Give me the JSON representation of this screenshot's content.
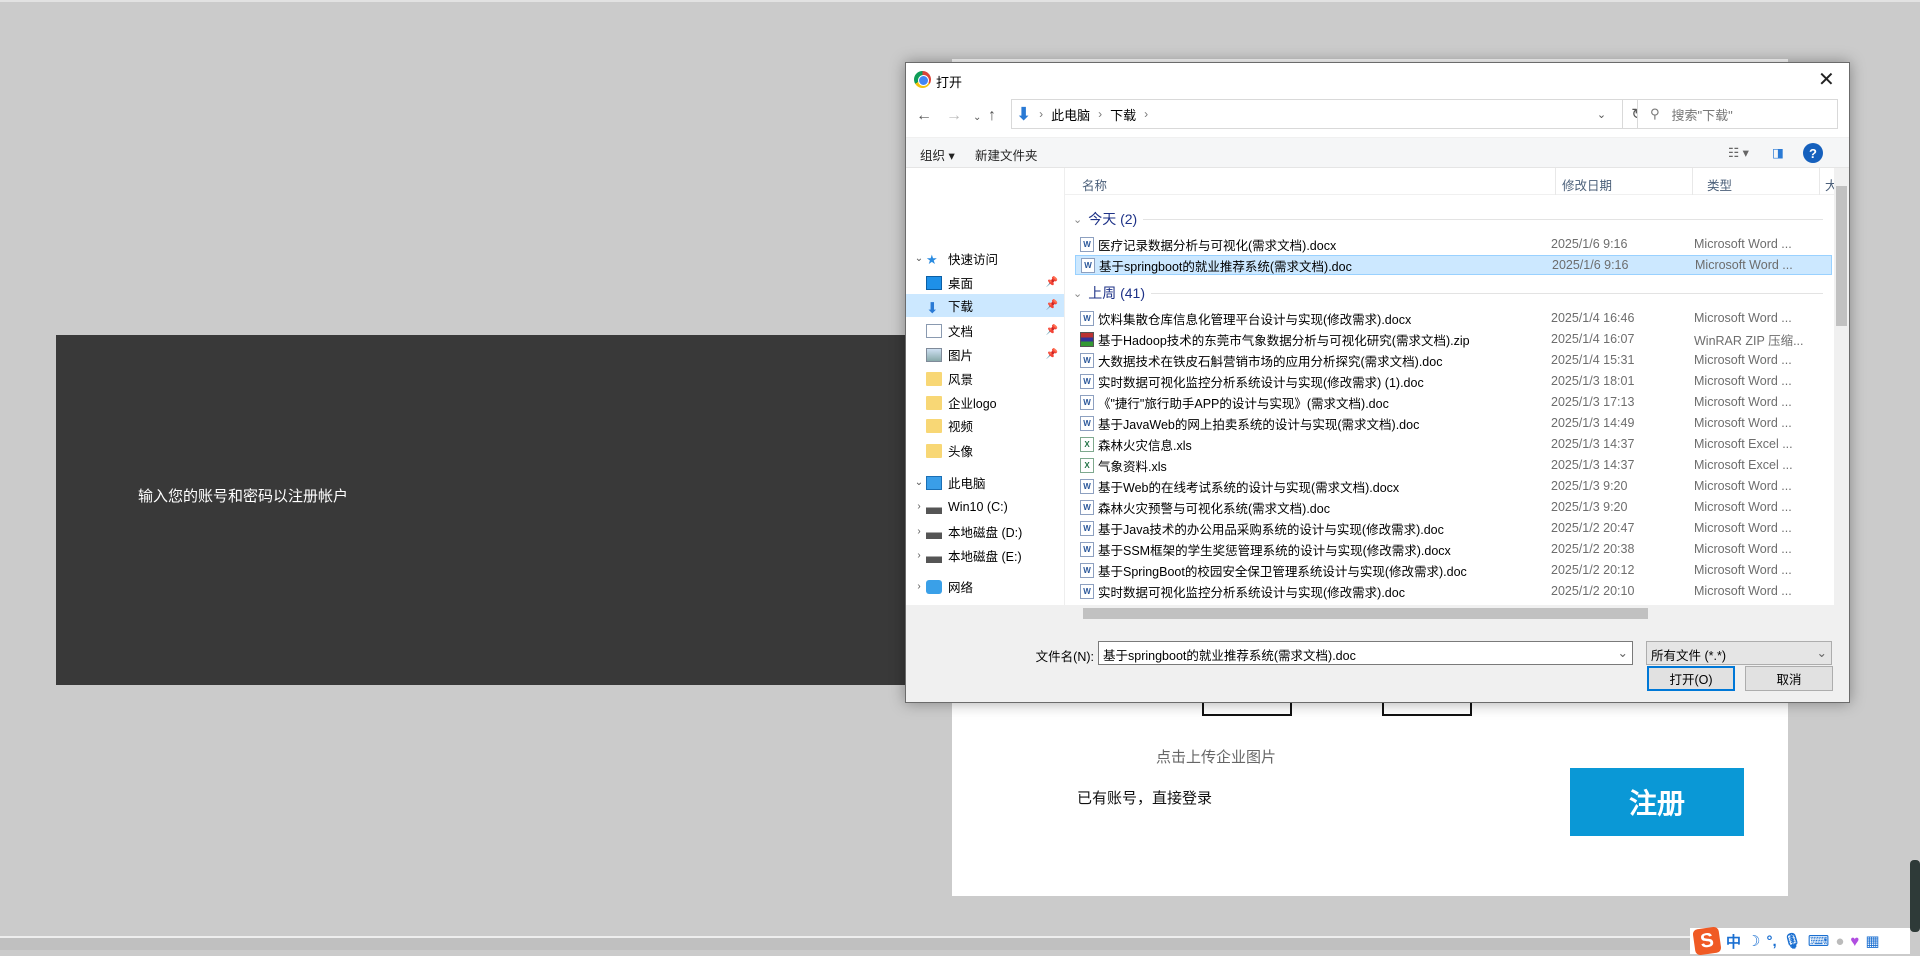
{
  "page": {
    "prompt": "输入您的账号和密码以注册帐户",
    "upload_text": "点击上传企业图片",
    "login_link": "已有账号，直接登录",
    "register_label": "注册",
    "accent": "#0a98d6",
    "panel_color": "#393939"
  },
  "ime": {
    "logo": "S",
    "mode": "中",
    "icons": [
      "moon-icon",
      "punctuation-icon",
      "microphone-icon",
      "keyboard-icon",
      "user-icon",
      "skin-icon",
      "apps-icon"
    ]
  },
  "dialog": {
    "title": "打开",
    "breadcrumb": [
      "此电脑",
      "下载"
    ],
    "search_placeholder": "搜索\"下载\"",
    "toolbar": {
      "organize": "组织 ▾",
      "new_folder": "新建文件夹"
    },
    "columns": {
      "name": "名称",
      "date": "修改日期",
      "type": "类型",
      "size": "大"
    },
    "sidebar": [
      {
        "label": "快速访问",
        "icon": "star-icon",
        "level": 0,
        "expand": "⌄"
      },
      {
        "label": "桌面",
        "icon": "desktop-icon",
        "level": 1,
        "pin": true
      },
      {
        "label": "下载",
        "icon": "download-icon",
        "level": 1,
        "pin": true,
        "selected": true
      },
      {
        "label": "文档",
        "icon": "document-icon",
        "level": 1,
        "pin": true
      },
      {
        "label": "图片",
        "icon": "pictures-icon",
        "level": 1,
        "pin": true
      },
      {
        "label": "风景",
        "icon": "folder-icon",
        "level": 1
      },
      {
        "label": "企业logo",
        "icon": "folder-icon",
        "level": 1
      },
      {
        "label": "视频",
        "icon": "folder-icon",
        "level": 1
      },
      {
        "label": "头像",
        "icon": "folder-icon",
        "level": 1
      },
      {
        "label": "此电脑",
        "icon": "computer-icon",
        "level": 0,
        "expand": "⌄"
      },
      {
        "label": "Win10 (C:)",
        "icon": "drive-icon",
        "level": 1,
        "expand": "›"
      },
      {
        "label": "本地磁盘 (D:)",
        "icon": "drive-icon",
        "level": 1,
        "expand": "›"
      },
      {
        "label": "本地磁盘 (E:)",
        "icon": "drive-icon",
        "level": 1,
        "expand": "›"
      },
      {
        "label": "网络",
        "icon": "network-icon",
        "level": 0,
        "expand": "›"
      }
    ],
    "groups": [
      {
        "label": "今天 (2)",
        "files": [
          {
            "name": "医疗记录数据分析与可视化(需求文档).docx",
            "date": "2025/1/6 9:16",
            "type": "Microsoft Word ...",
            "kind": "doc"
          },
          {
            "name": "基于springboot的就业推荐系统(需求文档).doc",
            "date": "2025/1/6 9:16",
            "type": "Microsoft Word ...",
            "kind": "doc",
            "selected": true
          }
        ]
      },
      {
        "label": "上周 (41)",
        "files": [
          {
            "name": "饮料集散仓库信息化管理平台设计与实现(修改需求).docx",
            "date": "2025/1/4 16:46",
            "type": "Microsoft Word ...",
            "kind": "doc"
          },
          {
            "name": "基于Hadoop技术的东莞市气象数据分析与可视化研究(需求文档).zip",
            "date": "2025/1/4 16:07",
            "type": "WinRAR ZIP 压缩...",
            "kind": "zip"
          },
          {
            "name": "大数据技术在铁皮石斛营销市场的应用分析探究(需求文档).doc",
            "date": "2025/1/4 15:31",
            "type": "Microsoft Word ...",
            "kind": "doc"
          },
          {
            "name": "实时数据可视化监控分析系统设计与实现(修改需求) (1).doc",
            "date": "2025/1/3 18:01",
            "type": "Microsoft Word ...",
            "kind": "doc"
          },
          {
            "name": "《\"捷行\"旅行助手APP的设计与实现》(需求文档).doc",
            "date": "2025/1/3 17:13",
            "type": "Microsoft Word ...",
            "kind": "doc"
          },
          {
            "name": "基于JavaWeb的网上拍卖系统的设计与实现(需求文档).doc",
            "date": "2025/1/3 14:49",
            "type": "Microsoft Word ...",
            "kind": "doc"
          },
          {
            "name": "森林火灾信息.xls",
            "date": "2025/1/3 14:37",
            "type": "Microsoft Excel ...",
            "kind": "xls"
          },
          {
            "name": "气象资料.xls",
            "date": "2025/1/3 14:37",
            "type": "Microsoft Excel ...",
            "kind": "xls"
          },
          {
            "name": "基于Web的在线考试系统的设计与实现(需求文档).docx",
            "date": "2025/1/3 9:20",
            "type": "Microsoft Word ...",
            "kind": "doc"
          },
          {
            "name": "森林火灾预警与可视化系统(需求文档).doc",
            "date": "2025/1/3 9:20",
            "type": "Microsoft Word ...",
            "kind": "doc"
          },
          {
            "name": "基于Java技术的办公用品采购系统的设计与实现(修改需求).doc",
            "date": "2025/1/2 20:47",
            "type": "Microsoft Word ...",
            "kind": "doc"
          },
          {
            "name": "基于SSM框架的学生奖惩管理系统的设计与实现(修改需求).docx",
            "date": "2025/1/2 20:38",
            "type": "Microsoft Word ...",
            "kind": "doc"
          },
          {
            "name": "基于SpringBoot的校园安全保卫管理系统设计与实现(修改需求).doc",
            "date": "2025/1/2 20:12",
            "type": "Microsoft Word ...",
            "kind": "doc"
          },
          {
            "name": "实时数据可视化监控分析系统设计与实现(修改需求).doc",
            "date": "2025/1/2 20:10",
            "type": "Microsoft Word ...",
            "kind": "doc"
          }
        ]
      }
    ],
    "filename_label": "文件名(N):",
    "filename_value": "基于springboot的就业推荐系统(需求文档).doc",
    "filter_value": "所有文件 (*.*)",
    "open_label": "打开(O)",
    "cancel_label": "取消"
  }
}
